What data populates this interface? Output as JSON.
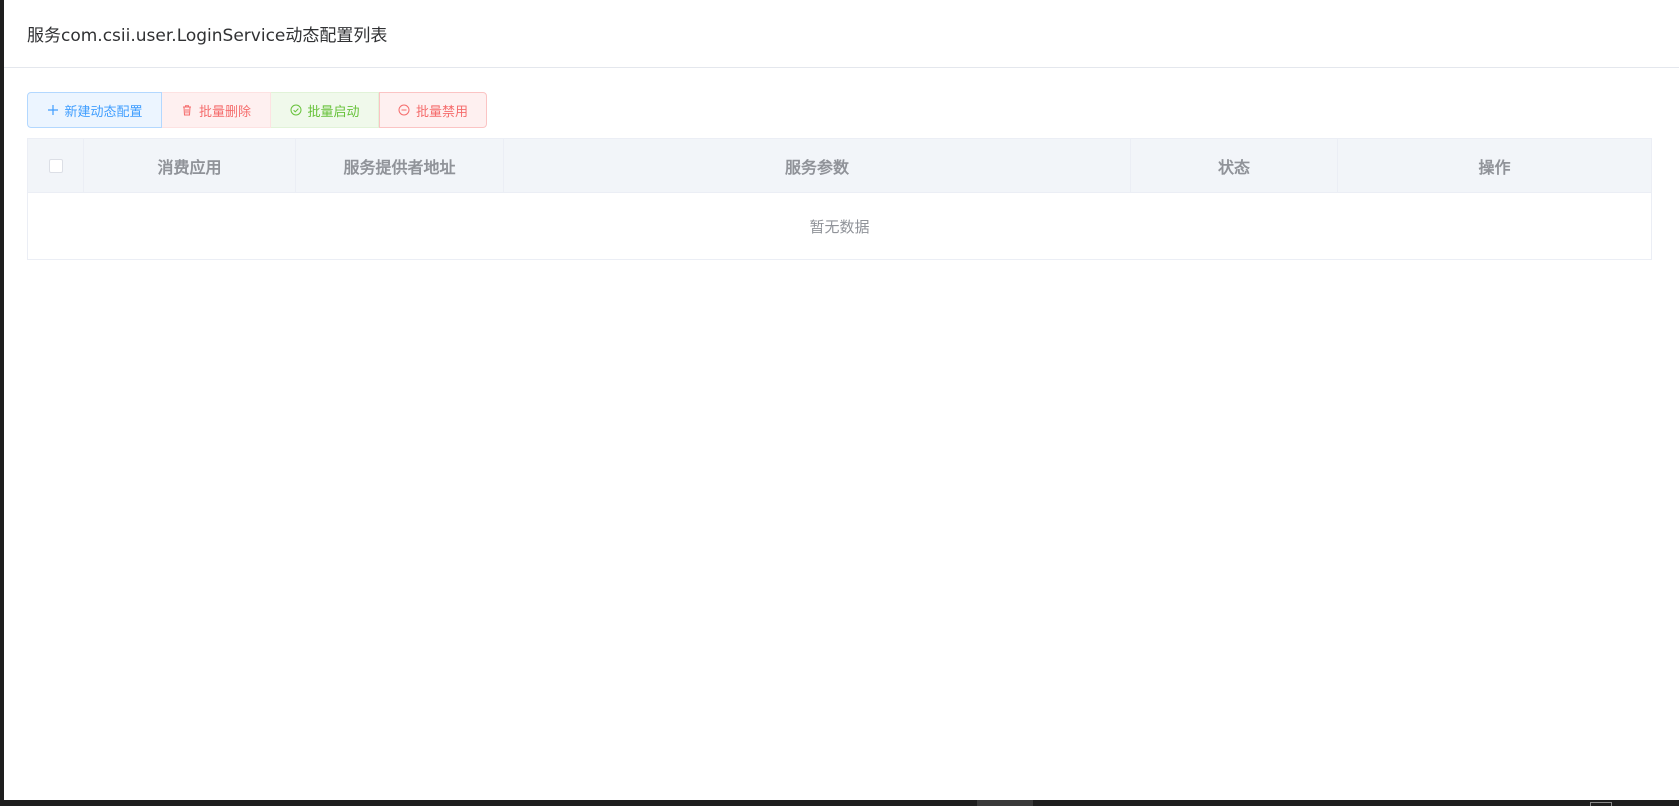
{
  "dialog": {
    "title": "服务com.csii.user.LoginService动态配置列表"
  },
  "toolbar": {
    "new_label": "新建动态配置",
    "batch_delete_label": "批量删除",
    "batch_enable_label": "批量启动",
    "batch_disable_label": "批量禁用"
  },
  "table": {
    "columns": [
      "消费应用",
      "服务提供者地址",
      "服务参数",
      "状态",
      "操作"
    ],
    "empty_text": "暂无数据"
  },
  "colors": {
    "primary": "#409eff",
    "danger": "#f56c6c",
    "success": "#67c23a",
    "header_bg": "#f2f5f9"
  },
  "icons": [
    "plus-icon",
    "trash-icon",
    "check-circle-icon",
    "minus-circle-icon"
  ]
}
